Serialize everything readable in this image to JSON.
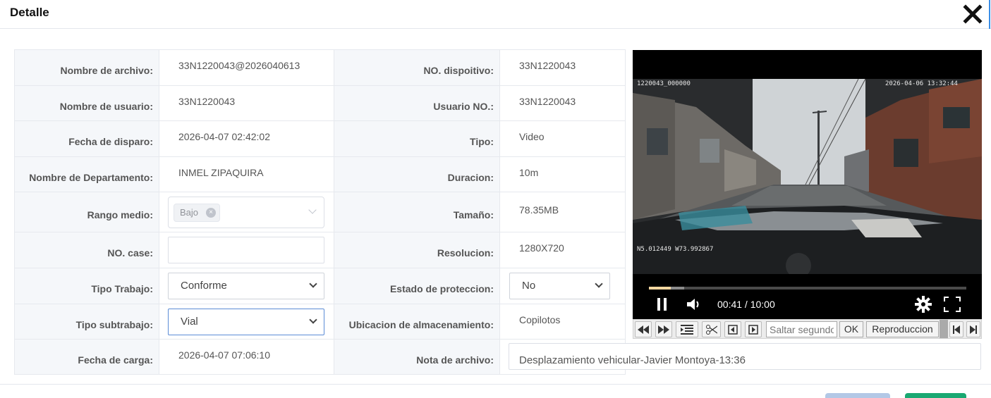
{
  "dialog": {
    "title": "Detalle"
  },
  "fields": {
    "file_name": {
      "label": "Nombre de archivo:",
      "value": "33N1220043@2026040613"
    },
    "device_no": {
      "label": "NO. dispoitivo:",
      "value": "33N1220043"
    },
    "user_name": {
      "label": "Nombre de usuario:",
      "value": "33N1220043"
    },
    "user_no": {
      "label": "Usuario NO.:",
      "value": "33N1220043"
    },
    "trigger_date": {
      "label": "Fecha de disparo:",
      "value": "2026-04-07 02:42:02"
    },
    "type": {
      "label": "Tipo:",
      "value": "Video"
    },
    "department": {
      "label": "Nombre de Departamento:",
      "value": "INMEL ZIPAQUIRA"
    },
    "duration": {
      "label": "Duracion:",
      "value": "10m"
    },
    "range": {
      "label": "Rango medio:",
      "tag": "Bajo"
    },
    "size": {
      "label": "Tamaño:",
      "value": "78.35MB"
    },
    "case_no": {
      "label": "NO. case:",
      "value": ""
    },
    "resolution": {
      "label": "Resolucion:",
      "value": "1280X720"
    },
    "work_type": {
      "label": "Tipo Trabajo:",
      "value": "Conforme"
    },
    "protection": {
      "label": "Estado de proteccion:",
      "value": "No"
    },
    "work_subtype": {
      "label": "Tipo subtrabajo:",
      "value": "Vial"
    },
    "storage": {
      "label": "Ubicacion de almacenamiento:",
      "value": "Copilotos"
    },
    "upload_date": {
      "label": "Fecha de carga:",
      "value": "2026-04-07 07:06:10"
    },
    "file_note": {
      "label": "Nota de archivo:",
      "value": "Desplazamiento vehicular-Javier Montoya-13:36"
    }
  },
  "video": {
    "osd_id": "1220043_000000",
    "osd_datetime": "2026-04-06 13:32:44",
    "osd_gps": "N5.012449  W73.992867",
    "time_display": "00:41 / 10:00",
    "played_fraction": 0.068,
    "buffered_fraction": 0.111
  },
  "video_toolbar": {
    "seek_placeholder": "Saltar segundo",
    "ok_label": "OK",
    "playback_label": "Reproduccion"
  },
  "colors": {
    "accent_blue": "#3a8ee6",
    "confirm_green": "#1aa872",
    "label_bg": "#f5f7fa"
  }
}
